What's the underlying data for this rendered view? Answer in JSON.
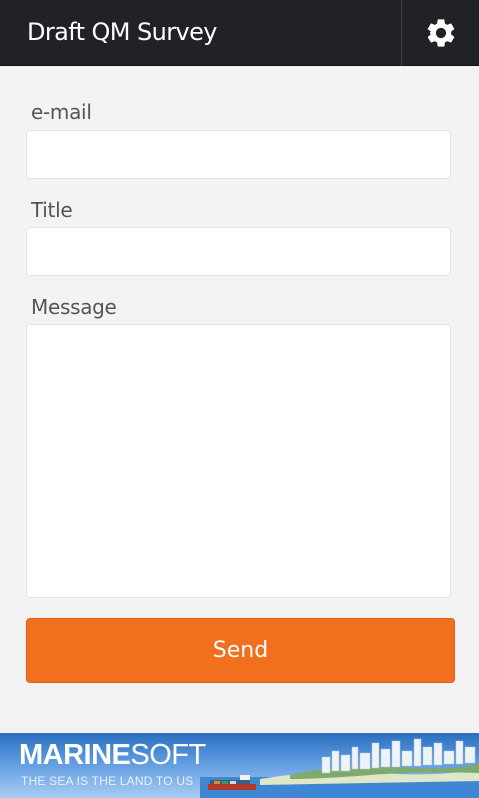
{
  "app": {
    "title": "Draft QM Survey"
  },
  "form": {
    "email": {
      "label": "e-mail",
      "value": "",
      "placeholder": ""
    },
    "title": {
      "label": "Title",
      "value": "",
      "placeholder": ""
    },
    "message": {
      "label": "Message",
      "value": "",
      "placeholder": ""
    },
    "send_label": "Send"
  },
  "banner": {
    "brand_bold": "MARINE",
    "brand_light": "SOFT",
    "tagline": "THE SEA IS THE LAND TO US"
  },
  "icons": {
    "settings": "gear-icon"
  },
  "colors": {
    "appbar_bg": "#202225",
    "page_bg": "#f3f3f3",
    "accent": "#f26f1e"
  }
}
